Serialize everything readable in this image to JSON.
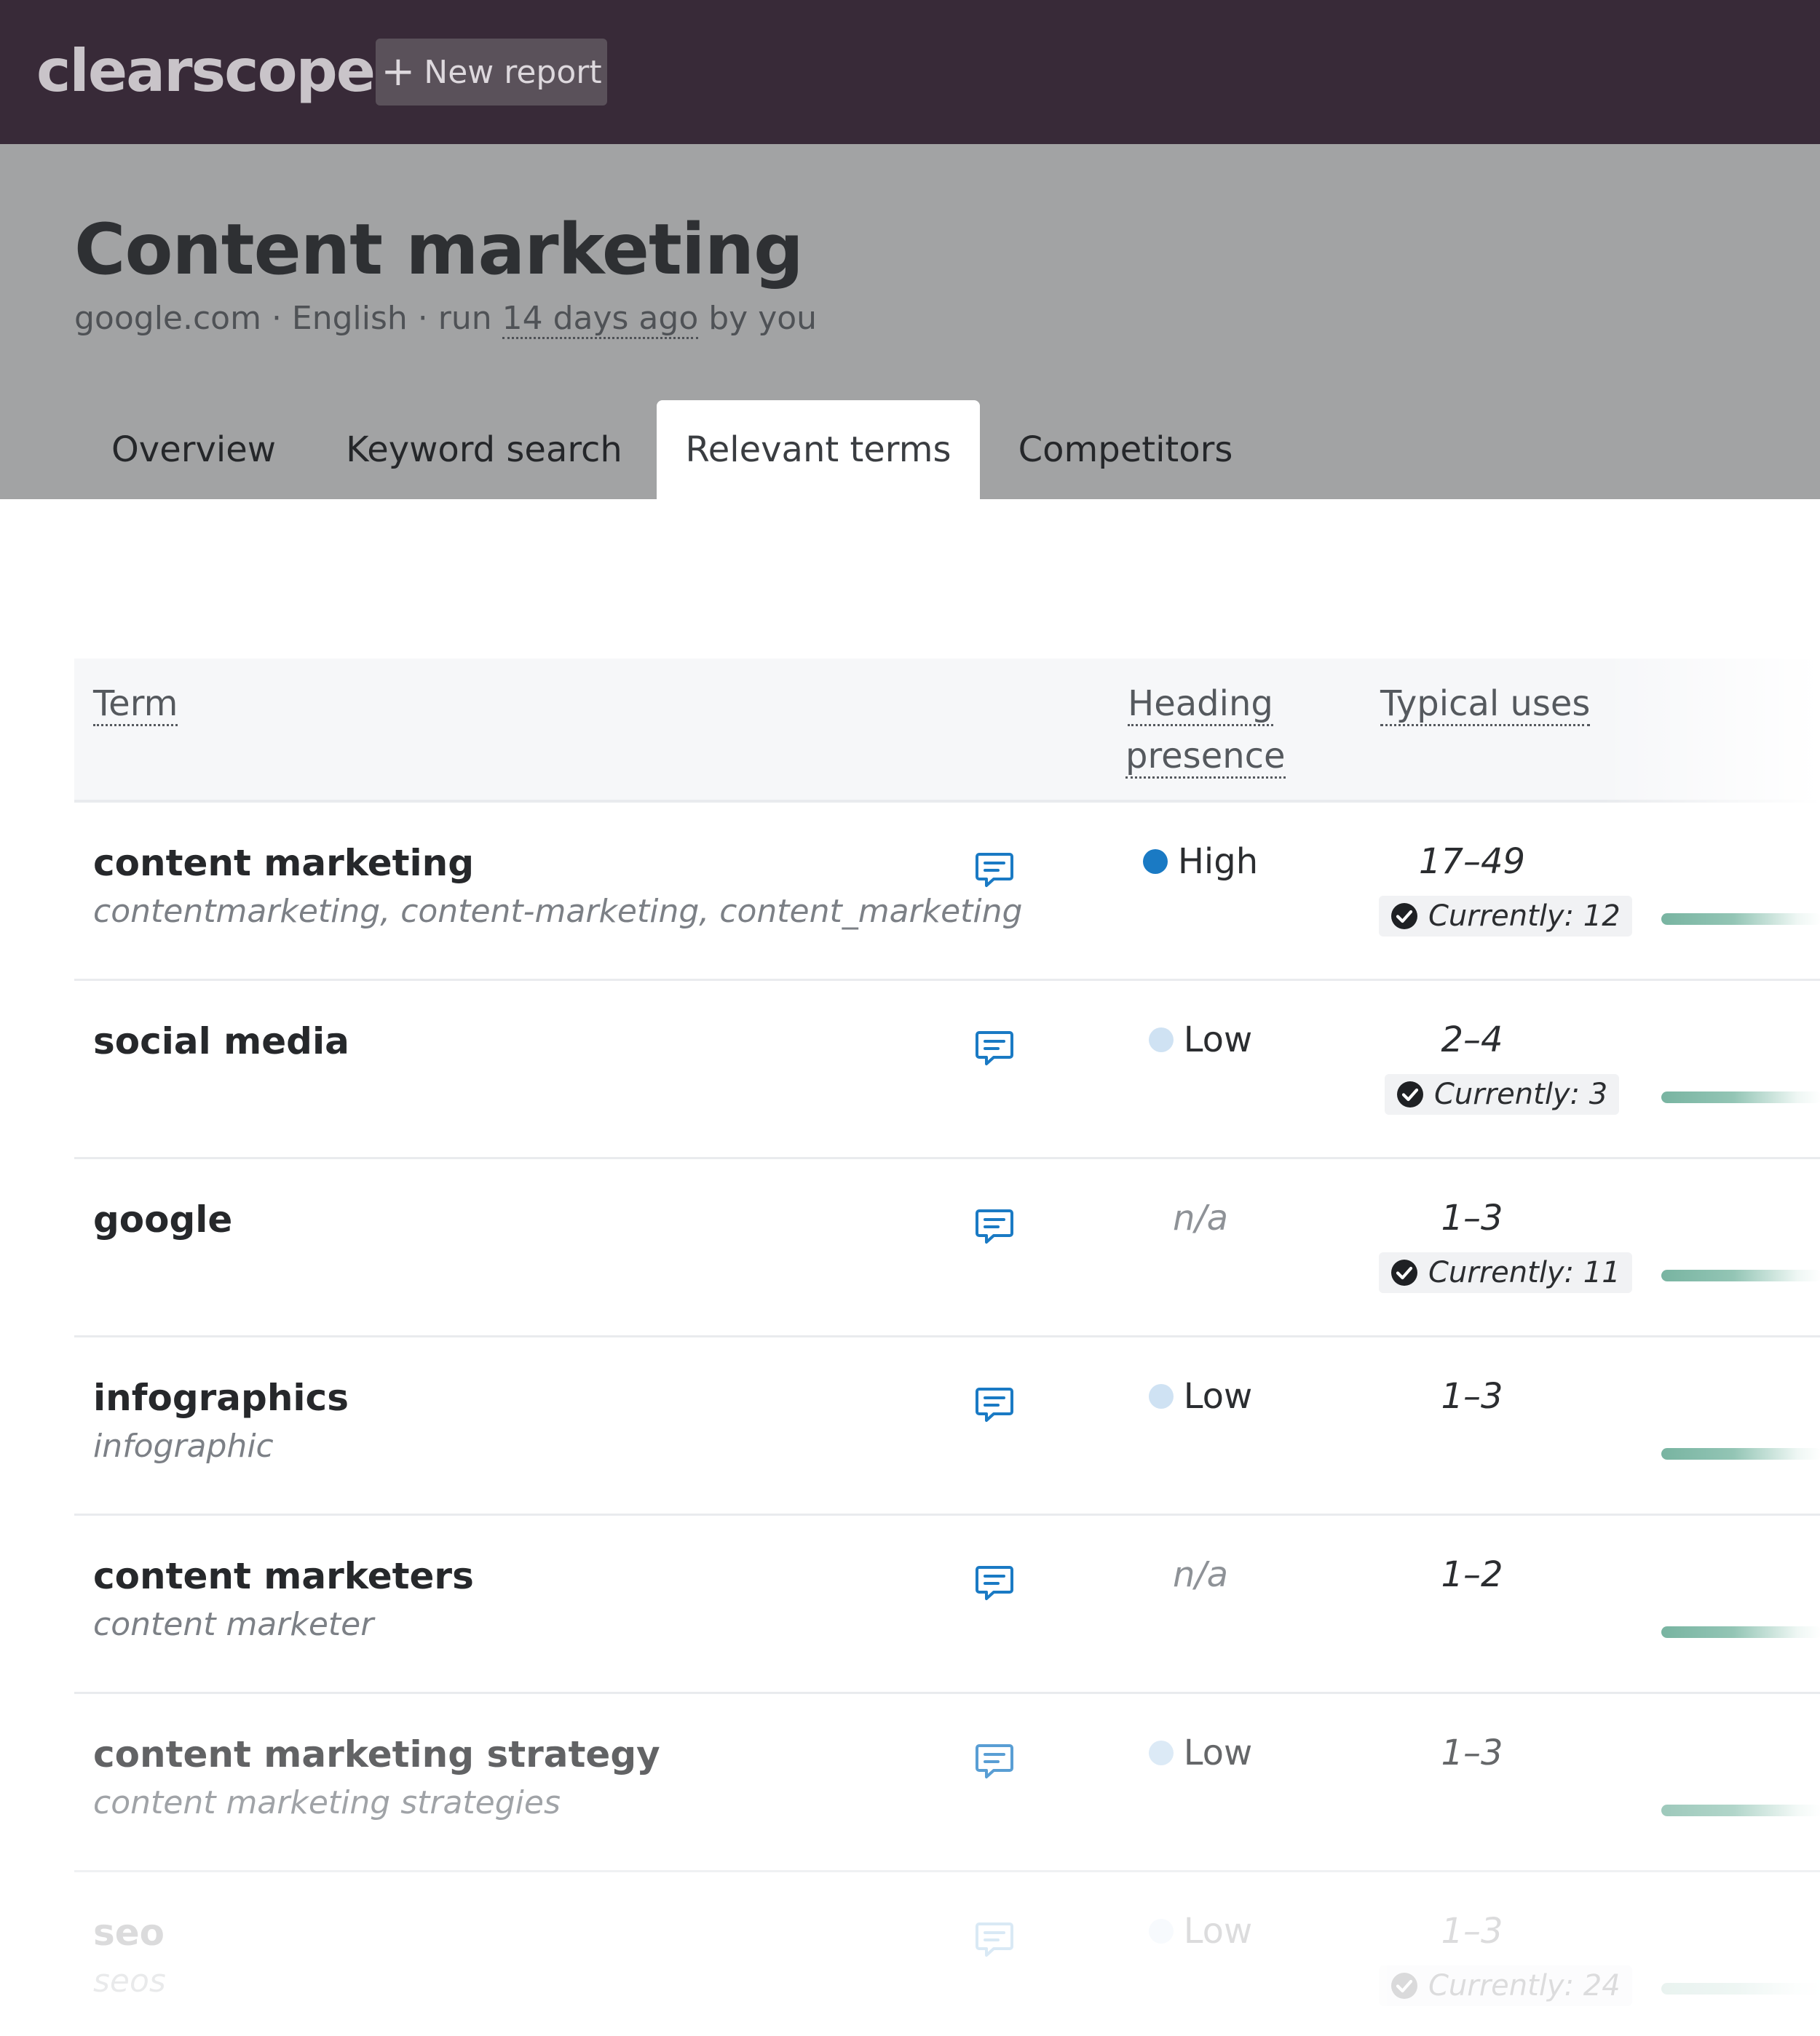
{
  "app": {
    "logo": "clearscope",
    "new_report_plus": "+",
    "new_report_label": "New report"
  },
  "report": {
    "title": "Content marketing",
    "meta_prefix": "google.com · English · run ",
    "meta_time": "14 days ago",
    "meta_suffix": " by you"
  },
  "tabs": [
    "Overview",
    "Keyword search",
    "Relevant terms",
    "Competitors"
  ],
  "active_tab": "Relevant terms",
  "table": {
    "headers": {
      "term": "Term",
      "heading_line1": "Heading",
      "heading_line2": "presence",
      "typical": "Typical uses"
    },
    "rows": [
      {
        "term": "content marketing",
        "variants": "contentmarketing, content-marketing, content_marketing",
        "presence": "High",
        "typical": "17–49",
        "current": "Currently: 12"
      },
      {
        "term": "social media",
        "variants": "",
        "presence": "Low",
        "typical": "2–4",
        "current": "Currently: 3"
      },
      {
        "term": "google",
        "variants": "",
        "presence": "n/a",
        "typical": "1–3",
        "current": "Currently: 11"
      },
      {
        "term": "infographics",
        "variants": "infographic",
        "presence": "Low",
        "typical": "1–3",
        "current": ""
      },
      {
        "term": "content marketers",
        "variants": "content marketer",
        "presence": "n/a",
        "typical": "1–2",
        "current": ""
      },
      {
        "term": "content marketing strategy",
        "variants": "content marketing strategies",
        "presence": "Low",
        "typical": "1–3",
        "current": ""
      },
      {
        "term": "seo",
        "variants": "seos",
        "presence": "Low",
        "typical": "1–3",
        "current": "Currently: 24"
      }
    ]
  },
  "icons": {
    "comment": "comment-icon",
    "check": "check-circle-icon",
    "plus": "plus-icon"
  },
  "colors": {
    "topbar": "#382a38",
    "header": "#a2a3a4",
    "presence_high": "#1a7ac4",
    "presence_low": "#cfe2f3",
    "accent_blue": "#1a7ac4",
    "bar": "#78b4a1"
  }
}
